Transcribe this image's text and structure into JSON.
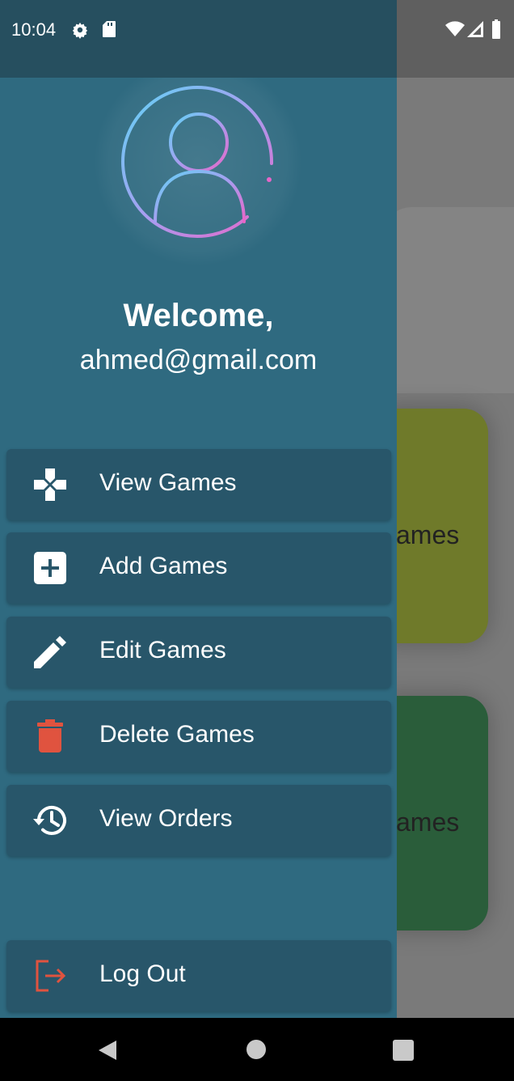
{
  "status_bar": {
    "time": "10:04",
    "icons": [
      "gear-icon",
      "sd-card-icon",
      "wifi-icon",
      "signal-icon",
      "battery-icon"
    ]
  },
  "background_app": {
    "cards": [
      {
        "label_fragment": "ames",
        "color": "#6f7a2a"
      },
      {
        "label_fragment": "ames",
        "color": "#2a5d3a"
      }
    ]
  },
  "drawer": {
    "header": {
      "avatar_icon": "user-avatar-icon",
      "welcome": "Welcome,",
      "email": "ahmed@gmail.com"
    },
    "menu": [
      {
        "label": "View Games",
        "icon": "gamepad-icon",
        "icon_color": "#ffffff"
      },
      {
        "label": "Add Games",
        "icon": "add-box-icon",
        "icon_color": "#ffffff"
      },
      {
        "label": "Edit Games",
        "icon": "pencil-icon",
        "icon_color": "#ffffff"
      },
      {
        "label": "Delete Games",
        "icon": "trash-icon",
        "icon_color": "#e0533f"
      },
      {
        "label": "View Orders",
        "icon": "history-icon",
        "icon_color": "#ffffff"
      }
    ],
    "logout": {
      "label": "Log Out",
      "icon": "logout-icon",
      "icon_color": "#e0533f"
    }
  },
  "colors": {
    "drawer_bg": "#2f6a80",
    "menu_item_bg": "#28566a",
    "accent_red": "#e0533f"
  },
  "nav_bar": {
    "icons": [
      "back-icon",
      "home-icon",
      "recent-apps-icon"
    ]
  }
}
